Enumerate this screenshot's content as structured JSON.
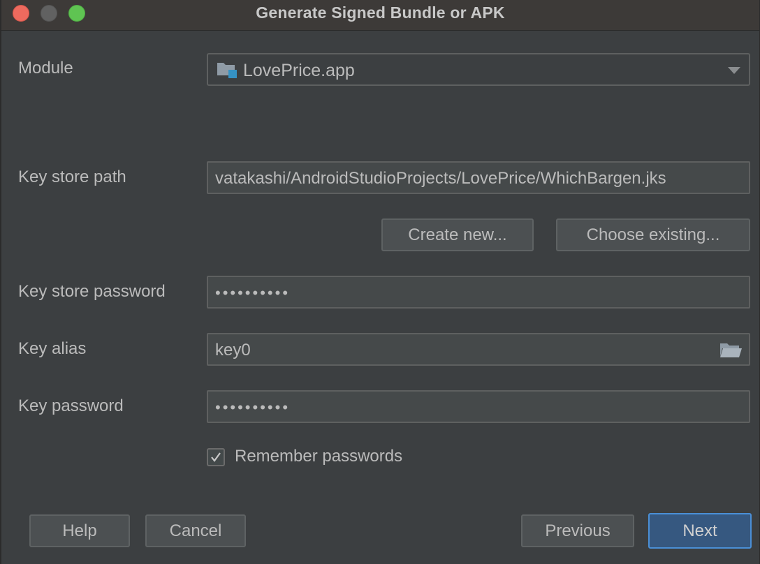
{
  "window": {
    "title": "Generate Signed Bundle or APK"
  },
  "module": {
    "label": "Module",
    "value": "LovePrice.app",
    "icon": "module-folder-icon"
  },
  "keystore": {
    "path_label": "Key store path",
    "path_value": "vatakashi/AndroidStudioProjects/LovePrice/WhichBargen.jks",
    "create_new_label": "Create new...",
    "choose_existing_label": "Choose existing...",
    "password_label": "Key store password",
    "password_value": "••••••••••"
  },
  "key": {
    "alias_label": "Key alias",
    "alias_value": "key0",
    "alias_icon": "folder-open-icon",
    "password_label": "Key password",
    "password_value": "••••••••••"
  },
  "remember": {
    "label": "Remember passwords",
    "checked": true
  },
  "footer": {
    "help_label": "Help",
    "cancel_label": "Cancel",
    "previous_label": "Previous",
    "next_label": "Next"
  },
  "colors": {
    "background": "#3c3f41",
    "default_button": "#365880",
    "default_button_border": "#4a8fd6",
    "text": "#bbbbbb"
  }
}
